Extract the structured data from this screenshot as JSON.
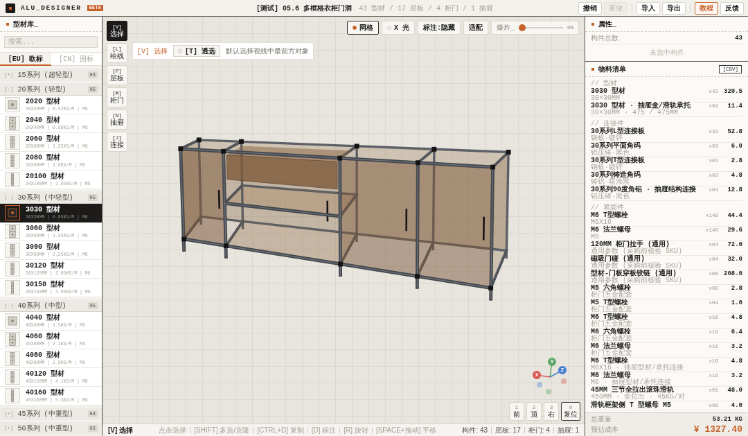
{
  "topbar": {
    "title": "ALU_DESIGNER",
    "badge": "BETA",
    "project": "[测试] 05.6 多框格衣柜门洞",
    "stats": "43 型材 / 17 层板 / 4 柜门 / 1 抽屉",
    "button_groups": [
      [
        {
          "label": "撤销",
          "disabled": false,
          "highlighted": false
        },
        {
          "label": "重做",
          "disabled": true,
          "highlighted": false
        }
      ],
      [
        {
          "label": "导入",
          "disabled": false,
          "highlighted": false
        },
        {
          "label": "导出",
          "disabled": false,
          "highlighted": false
        }
      ],
      [
        {
          "label": "教程",
          "disabled": false,
          "highlighted": true
        },
        {
          "label": "反馈",
          "disabled": false,
          "highlighted": false
        }
      ]
    ]
  },
  "library": {
    "title": "型材库_",
    "search": {
      "placeholder": "搜索..."
    },
    "tabs": [
      {
        "label": "[EU] 欧标",
        "selected": true
      },
      {
        "label": "[CN] 国标",
        "selected": false
      }
    ],
    "groups": [
      {
        "toggle": "[+]",
        "label": "15系列 (超轻型)",
        "count": "03",
        "expanded": false
      },
      {
        "toggle": "[-]",
        "label": "20系列 (轻型)",
        "count": "05",
        "expanded": true,
        "items": [
          {
            "name": "2020 型材",
            "spec": "20X20MM | 0.52KG/M | M6",
            "selected": false
          },
          {
            "name": "2040 型材",
            "spec": "20X40MM | 0.89KG/M | M6",
            "selected": false
          },
          {
            "name": "2060 型材",
            "spec": "20X60MM | 1.25KG/M | M6",
            "selected": false
          },
          {
            "name": "2080 型材",
            "spec": "20X80MM | 1.6KG/M | M6",
            "selected": false
          },
          {
            "name": "20100 型材",
            "spec": "20X100MM | 1.95KG/M | M6",
            "selected": false
          }
        ]
      },
      {
        "toggle": "[-]",
        "label": "30系列 (中轻型)",
        "count": "05",
        "expanded": true,
        "items": [
          {
            "name": "3030 型材",
            "spec": "30X30MM | 0.85KG/M | M6",
            "selected": true
          },
          {
            "name": "3060 型材",
            "spec": "30X60MM | 1.55KG/M | M6",
            "selected": false
          },
          {
            "name": "3090 型材",
            "spec": "30X90MM | 2.25KG/M | M6",
            "selected": false
          },
          {
            "name": "30120 型材",
            "spec": "30X120MM | 2.95KG/M | M6",
            "selected": false
          },
          {
            "name": "30150 型材",
            "spec": "30X150MM | 3.65KG/M | M6",
            "selected": false
          }
        ]
      },
      {
        "toggle": "[-]",
        "label": "40系列 (中型)",
        "count": "05",
        "expanded": true,
        "items": [
          {
            "name": "4040 型材",
            "spec": "40X40MM | 1.5KG/M | M8",
            "selected": false
          },
          {
            "name": "4060 型材",
            "spec": "40X60MM | 2.1KG/M | M8",
            "selected": false
          },
          {
            "name": "4080 型材",
            "spec": "40X80MM | 2.9KG/M | M8",
            "selected": false
          },
          {
            "name": "40120 型材",
            "spec": "40X120MM | 4.1KG/M | M8",
            "selected": false
          },
          {
            "name": "40160 型材",
            "spec": "40X160MM | 5.3KG/M | M8",
            "selected": false
          }
        ]
      },
      {
        "toggle": "[+]",
        "label": "45系列 (中重型)",
        "count": "04",
        "expanded": false
      },
      {
        "toggle": "[+]",
        "label": "50系列 (中重型)",
        "count": "02",
        "expanded": false
      }
    ]
  },
  "viewport": {
    "tools": [
      {
        "key": "[V]",
        "label": "选择",
        "selected": true
      },
      {
        "key": "[L]",
        "label": "绘线",
        "selected": false
      },
      {
        "key": "[P]",
        "label": "层板",
        "selected": false
      },
      {
        "key": "[M]",
        "label": "柜门",
        "selected": false
      },
      {
        "key": "[N]",
        "label": "抽屉",
        "selected": false
      },
      {
        "key": "[J]",
        "label": "连接",
        "selected": false
      }
    ],
    "hint": {
      "mode": "[V] 选择",
      "toggle": {
        "label": "[T] 透选",
        "on": false
      },
      "text": "默认选择视线中最前方对象"
    },
    "toolbar": [
      {
        "kind": "toggle",
        "label": "网格",
        "on": true
      },
      {
        "kind": "toggle",
        "label": "X 光",
        "on": false
      },
      {
        "kind": "button",
        "label": "标注:隐藏"
      },
      {
        "kind": "button",
        "label": "适配"
      },
      {
        "kind": "slider",
        "label": "爆炸_",
        "level": 0,
        "reading": "0%"
      }
    ],
    "gizmo": {
      "axes": [
        {
          "label": "Y",
          "color": "#5ea86a"
        },
        {
          "label": "Z",
          "color": "#4a80d0"
        },
        {
          "label": "X",
          "color": "#d65a52"
        }
      ]
    },
    "views": [
      {
        "key": "1",
        "label": "前",
        "kind": "view"
      },
      {
        "key": "2",
        "label": "顶",
        "kind": "view"
      },
      {
        "key": "3",
        "label": "右",
        "kind": "view"
      },
      {
        "key": "0",
        "label": "复位",
        "kind": "reset"
      }
    ]
  },
  "status_bar": {
    "mode": "[V] 选择",
    "hints": [
      "点击选择",
      "[SHIFT] 多选/克隆",
      "[CTRL+D] 复制",
      "[D] 标注",
      "[R] 旋转",
      "[SPACE+拖动] 平移"
    ],
    "counts": [
      "构件: 43",
      "层板: 17",
      "柜门: 4",
      "抽屉: 1"
    ]
  },
  "properties": {
    "title": "属性_",
    "rows": [
      {
        "label": "构件总数",
        "value": "43"
      }
    ],
    "empty": "未选中构件"
  },
  "bom": {
    "title": "物料清单",
    "export": "[CSV]",
    "sections": [
      {
        "title": "// 型材",
        "items": [
          {
            "name": "3030 型材",
            "spec": "30×30MM",
            "qty": "x43",
            "weight": "320.5"
          },
          {
            "name": "3030 型材 · 抽屉盒/滑轨承托",
            "spec": "30×30MM · 475 / 475MM",
            "qty": "x02",
            "weight": "11.4"
          }
        ]
      },
      {
        "title": "// 连接件",
        "items": [
          {
            "name": "30系列L型连接板",
            "spec": "钢板·镀锌",
            "qty": "x33",
            "weight": "52.8"
          },
          {
            "name": "30系列平面角码",
            "spec": "铝压铸·黑色",
            "qty": "x03",
            "weight": "6.0"
          },
          {
            "name": "30系列T型连接板",
            "spec": "钢板·镀锌",
            "qty": "x01",
            "weight": "2.8"
          },
          {
            "name": "30系列铸造角码",
            "spec": "铸铝·喷涂黑",
            "qty": "x02",
            "weight": "4.8"
          },
          {
            "name": "30系列90度角铝 · 抽屉结构连接",
            "spec": "铝压铸·黑色",
            "qty": "x04",
            "weight": "12.8"
          }
        ]
      },
      {
        "title": "// 紧固件",
        "items": [
          {
            "name": "M6 T型螺栓",
            "spec": "M6X16",
            "qty": "x148",
            "weight": "44.4"
          },
          {
            "name": "M6 法兰螺母",
            "spec": "M6",
            "qty": "x148",
            "weight": "29.6"
          },
          {
            "name": "120MM 柜门拉手 (通用)",
            "spec": "通用参数 (采购前核验 SKU)",
            "qty": "x04",
            "weight": "72.0"
          },
          {
            "name": "磁吸门碰 (通用)",
            "spec": "通用参数 (采购前核验 SKU)",
            "qty": "x04",
            "weight": "32.0"
          },
          {
            "name": "型材-门板穿板铰链 (通用)",
            "spec": "通用参数 (采购前核验 SKU)",
            "qty": "x08",
            "weight": "208.0"
          },
          {
            "name": "M5 六角螺栓",
            "spec": "柜门五金配套",
            "qty": "x08",
            "weight": "2.8"
          },
          {
            "name": "M5 T型螺栓",
            "spec": "柜门五金配套",
            "qty": "x04",
            "weight": "1.0"
          },
          {
            "name": "M6 T型螺栓",
            "spec": "柜门五金配套",
            "qty": "x16",
            "weight": "4.8"
          },
          {
            "name": "M6 六角螺栓",
            "spec": "柜门五金配套",
            "qty": "x16",
            "weight": "6.4"
          },
          {
            "name": "M6 法兰螺母",
            "spec": "柜门五金配套",
            "qty": "x16",
            "weight": "3.2"
          },
          {
            "name": "M6 T型螺栓",
            "spec": "M6X16 · 抽屉型材/承托连接",
            "qty": "x16",
            "weight": "4.8"
          },
          {
            "name": "M6 法兰螺母",
            "spec": "M6 · 抽屉型材/承托连接",
            "qty": "x16",
            "weight": "3.2"
          },
          {
            "name": "45MM 三节全拉出滚珠滑轨",
            "spec": "450MM · 全拉出 · 45KG/对",
            "qty": "x01",
            "weight": "48.0"
          },
          {
            "name": "滑轨框架侧 T 型螺母 M5",
            "qty": "x08",
            "weight": "4.0"
          }
        ]
      }
    ]
  },
  "totals": [
    {
      "kind": "weight",
      "label": "总重量",
      "value": "53.21 KG"
    },
    {
      "kind": "cost",
      "label": "预估成本",
      "value": "¥ 1327.40"
    }
  ]
}
